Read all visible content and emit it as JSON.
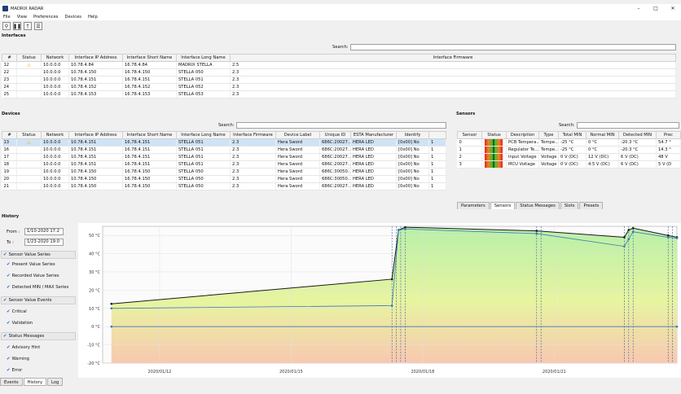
{
  "app": {
    "title": "MADRIX RADAR"
  },
  "menu": [
    "File",
    "View",
    "Preferences",
    "Devices",
    "Help"
  ],
  "colors": {
    "accent": "#1e3c78",
    "selection": "#cfe3f6",
    "warning": "#f0b400",
    "chart_fill_top": "#b8f0a8",
    "chart_fill_bottom": "#f8c8b0",
    "series_present": "#1a1a1a",
    "series_recorded": "#3a78b8"
  },
  "interfaces": {
    "title": "Interfaces",
    "search_label": "Search:",
    "columns": [
      "#",
      "Status",
      "Network",
      "Interface IP Address",
      "Interface Short Name",
      "Interface Long Name",
      "Interface Firmware"
    ],
    "rows": [
      {
        "num": "12",
        "status": "warning",
        "network": "10.0.0.0",
        "ip": "10.78.4.84",
        "short": "16.78.4.84",
        "long": "MADRIX STELLA",
        "fw": "2.5"
      },
      {
        "num": "22",
        "status": "",
        "network": "10.0.0.0",
        "ip": "10.78.4.150",
        "short": "16.78.4.150",
        "long": "STELLA 050",
        "fw": "2.3"
      },
      {
        "num": "23",
        "status": "",
        "network": "10.0.0.0",
        "ip": "10.78.4.151",
        "short": "16.78.4.151",
        "long": "STELLA 051",
        "fw": "2.3"
      },
      {
        "num": "24",
        "status": "",
        "network": "10.0.0.0",
        "ip": "10.78.4.152",
        "short": "16.78.4.152",
        "long": "STELLA 052",
        "fw": "2.3"
      },
      {
        "num": "25",
        "status": "",
        "network": "10.0.0.0",
        "ip": "10.78.4.153",
        "short": "16.78.4.153",
        "long": "STELLA 053",
        "fw": "2.3"
      }
    ]
  },
  "devices": {
    "title": "Devices",
    "search_label": "Search:",
    "columns": [
      "#",
      "Status",
      "Network",
      "Interface IP Address",
      "Interface Short Name",
      "Interface Long Name",
      "Interface Firmware",
      "Device Label",
      "Unique ID",
      "ESTA Manufacturer",
      "Identify",
      ""
    ],
    "rows": [
      {
        "num": "13",
        "status": "warning",
        "network": "10.0.0.0",
        "ip": "10.78.4.151",
        "short": "16.78.4.151",
        "long": "STELLA 051",
        "fw": "2.3",
        "label": "Hera Sword",
        "uid": "686C:20027...",
        "esta": "HERA LED",
        "identify": "[0x00] No",
        "x": "1",
        "sel": true
      },
      {
        "num": "16",
        "status": "",
        "network": "10.0.0.0",
        "ip": "10.78.4.151",
        "short": "16.78.4.151",
        "long": "STELLA 051",
        "fw": "2.3",
        "label": "Hera Sword",
        "uid": "686C:20027...",
        "esta": "HERA LED",
        "identify": "[0x00] No",
        "x": "1",
        "sel": false
      },
      {
        "num": "17",
        "status": "",
        "network": "10.0.0.0",
        "ip": "10.78.4.151",
        "short": "16.78.4.151",
        "long": "STELLA 051",
        "fw": "2.3",
        "label": "Hera Sword",
        "uid": "686C:20027...",
        "esta": "HERA LED",
        "identify": "[0x00] No",
        "x": "1",
        "sel": false
      },
      {
        "num": "18",
        "status": "",
        "network": "10.0.0.0",
        "ip": "10.78.4.151",
        "short": "16.78.4.151",
        "long": "STELLA 051",
        "fw": "2.3",
        "label": "Hera Sword",
        "uid": "686C:20027...",
        "esta": "HERA LED",
        "identify": "[0x00] No",
        "x": "1",
        "sel": false
      },
      {
        "num": "19",
        "status": "",
        "network": "10.0.0.0",
        "ip": "10.78.4.150",
        "short": "16.78.4.150",
        "long": "STELLA 050",
        "fw": "2.3",
        "label": "Hera Sword",
        "uid": "686C:30050...",
        "esta": "HERA LED",
        "identify": "[0x00] No",
        "x": "1",
        "sel": false
      },
      {
        "num": "20",
        "status": "",
        "network": "10.0.0.0",
        "ip": "10.78.4.150",
        "short": "16.78.4.150",
        "long": "STELLA 050",
        "fw": "2.3",
        "label": "Hera Sword",
        "uid": "686C:30050...",
        "esta": "HERA LED",
        "identify": "[0x00] No",
        "x": "1",
        "sel": false
      },
      {
        "num": "21",
        "status": "",
        "network": "10.0.0.0",
        "ip": "10.78.4.150",
        "short": "16.78.4.150",
        "long": "STELLA 050",
        "fw": "2.3",
        "label": "Hera Sword",
        "uid": "686C:20027...",
        "esta": "HERA LED",
        "identify": "[0x00] No",
        "x": "1",
        "sel": false
      }
    ]
  },
  "sensors": {
    "title": "Sensors",
    "search_label": "Search:",
    "columns": [
      "Sensor",
      "Status",
      "Description",
      "Type",
      "Total MIN",
      "Normal MIN",
      "Detected MIN",
      "Prec"
    ],
    "rows": [
      {
        "sensor": "0",
        "desc": "PCB Tempera...",
        "type": "Tempe...",
        "tmin": "-25 °C",
        "nmin": "0 °C",
        "dmin": "-20.3 °C",
        "prec": "54.7 °"
      },
      {
        "sensor": "1",
        "desc": "Regulator Te...",
        "type": "Tempe...",
        "tmin": "-25 °C",
        "nmin": "0 °C",
        "dmin": "-20.3 °C",
        "prec": "14.3 °"
      },
      {
        "sensor": "2",
        "desc": "Input Voltage",
        "type": "Voltage",
        "tmin": "0 V (DC)",
        "nmin": "12 V (DC)",
        "dmin": "6 V (DC)",
        "prec": "48 V"
      },
      {
        "sensor": "3",
        "desc": "MCU Voltage",
        "type": "Voltage",
        "tmin": "0 V (DC)",
        "nmin": "4.5 V (DC)",
        "dmin": "6 V (DC)",
        "prec": "5 V (D"
      }
    ],
    "tabs": [
      "Parameters",
      "Sensors",
      "Status Messages",
      "Slots",
      "Presets"
    ]
  },
  "history": {
    "title": "History",
    "from_label": "From :",
    "from_value": "1/10-2020 17:2",
    "to_label": "To :",
    "to_value": "1/23-2020 19:0",
    "sensor_value_series": "Sensor Value Series",
    "present_value_series": "Present Value Series",
    "recorded_value_series": "Recorded Value Series",
    "detected_minmax_series": "Detected MIN / MAX Series",
    "sensor_value_events": "Sensor Value Events",
    "critical": "Critical",
    "validation": "Validation",
    "status_messages": "Status Messages",
    "advisory_hint": "Advisory Hint",
    "warning": "Warning",
    "error": "Error"
  },
  "bottom_tabs": [
    "Events",
    "History",
    "Log"
  ],
  "chart_data": {
    "type": "line",
    "yticks": [
      "50 °C",
      "40 °C",
      "30 °C",
      "20 °C",
      "10 °C",
      "0 °C",
      "-10 °C",
      "-20 °C"
    ],
    "xticks": [
      "2020/01/12",
      "2020/01/15",
      "2020/01/18",
      "2020/01/21"
    ],
    "ylim": [
      -20,
      55
    ],
    "xlim": [
      10.7,
      23.8
    ],
    "series": [
      {
        "values": [
          [
            10.9,
            12.5
          ],
          [
            17.3,
            26
          ],
          [
            17.45,
            53
          ],
          [
            17.6,
            54.5
          ],
          [
            20.6,
            52.5
          ],
          [
            22.6,
            49
          ],
          [
            22.7,
            53
          ],
          [
            22.8,
            54
          ],
          [
            23.6,
            50
          ],
          [
            23.8,
            49
          ]
        ]
      },
      {
        "values": [
          [
            10.9,
            10
          ],
          [
            17.3,
            11.5
          ],
          [
            17.45,
            53
          ],
          [
            17.6,
            53.5
          ],
          [
            20.6,
            51
          ],
          [
            22.6,
            44
          ],
          [
            22.7,
            48
          ],
          [
            22.8,
            52
          ],
          [
            23.6,
            49
          ],
          [
            23.8,
            48.5
          ]
        ]
      },
      {
        "values": [
          [
            10.9,
            0
          ],
          [
            23.8,
            0
          ]
        ]
      }
    ]
  }
}
